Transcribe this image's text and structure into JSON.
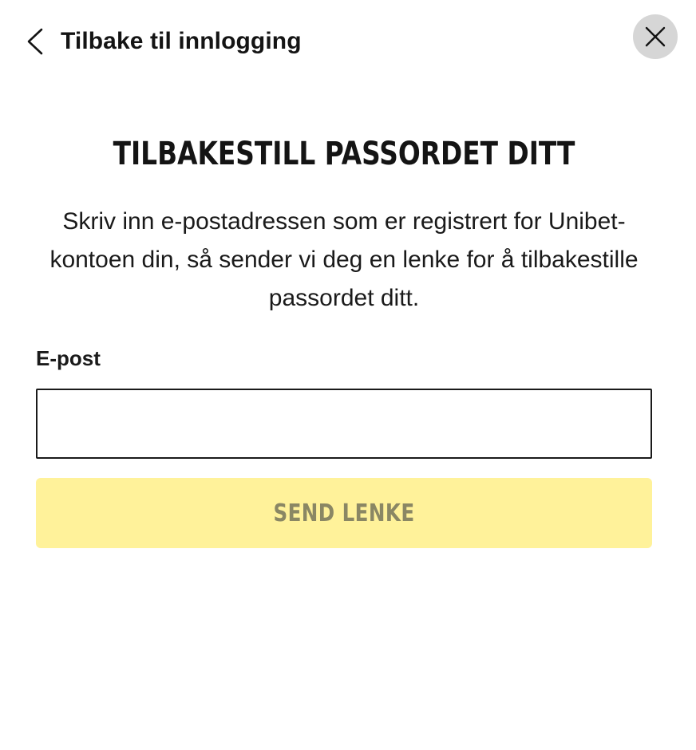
{
  "header": {
    "back_label": "Tilbake til innlogging",
    "back_icon": "chevron-left-icon",
    "close_icon": "close-icon"
  },
  "title": "TILBAKESTILL PASSORDET DITT",
  "description": "Skriv inn e-postadressen som er registrert for Unibet-kontoen din, så sender vi deg en lenke for å tilbakestille passordet ditt.",
  "form": {
    "email_label": "E-post",
    "email_value": "",
    "email_placeholder": "",
    "submit_label": "SEND LENKE",
    "submit_disabled": true
  },
  "colors": {
    "button_bg": "#fff29a",
    "button_text": "#8a8764",
    "close_bg": "#d6d6d6",
    "text": "#141414"
  }
}
